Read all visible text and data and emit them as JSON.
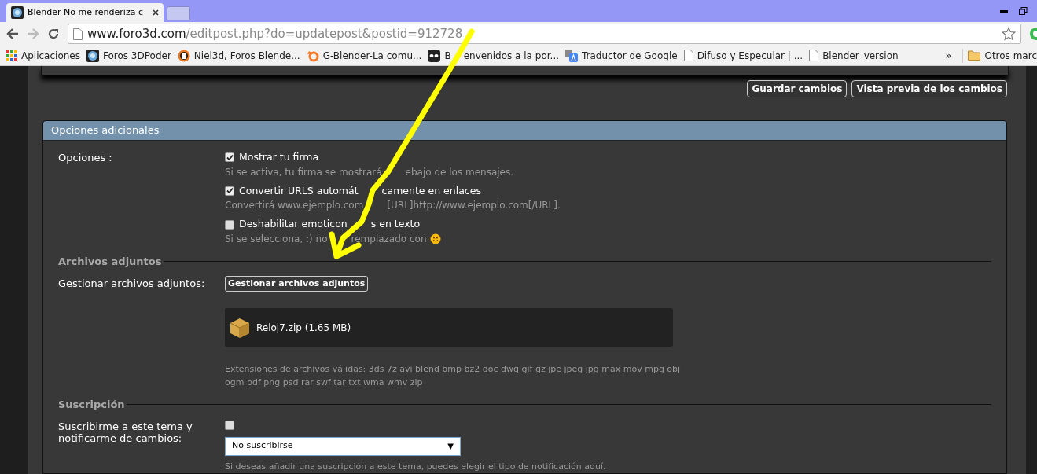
{
  "browser": {
    "tab_title": "Blender No me renderiza c",
    "url_host": "www.foro3d.com",
    "url_path": "/editpost.php?do=updatepost&postid=912728",
    "bookmarks": [
      {
        "label": [
          "Aplicaciones"
        ],
        "kind": "apps"
      },
      {
        "label": [
          "Foros 3DPoder"
        ],
        "kind": "globe"
      },
      {
        "label": [
          "Niel3d, Foros Blende..."
        ],
        "kind": "niel"
      },
      {
        "label": [
          "G-Blender-La comu..."
        ],
        "kind": "blender"
      },
      {
        "label": [
          "B",
          "envenidos a la por..."
        ],
        "kind": "mask"
      },
      {
        "label": [
          "Traductor de Google"
        ],
        "kind": "translate"
      },
      {
        "label": [
          "Difuso y Especular | ..."
        ],
        "kind": "page"
      },
      {
        "label": [
          "Blender_version"
        ],
        "kind": "page"
      }
    ],
    "overflow": "»",
    "other_bookmarks": "Otros marc"
  },
  "buttons": [
    "Guardar cambios",
    "Vista previa de los cambios"
  ],
  "panel": {
    "title": "Opciones adicionales",
    "options_label": "Opciones :",
    "options": [
      {
        "label": [
          "Mostrar tu firma"
        ],
        "checked": true,
        "hint": [
          "Si se activa, tu firma se mostrará",
          "ebajo de los mensajes."
        ]
      },
      {
        "label": [
          "Convertir URLS automát",
          "camente en enlaces"
        ],
        "checked": true,
        "hint": [
          "Convertirá www.ejemplo.com",
          "[URL]http://www.ejemplo.com[/URL]."
        ]
      },
      {
        "label": [
          "Deshabilitar emoticon",
          "s en texto"
        ],
        "checked": false,
        "hint": [
          "Si se selecciona, :) no",
          "remplazado con"
        ]
      }
    ],
    "attachments": {
      "heading": "Archivos adjuntos",
      "label": "Gestionar archivos adjuntos:",
      "button": "Gestionar archivos adjuntos",
      "file": "Reloj7.zip (1.65 MB)",
      "extensions": "Extensiones de archivos válidas: 3ds 7z avi blend bmp bz2 doc dwg gif gz jpe jpeg jpg max mov mpg obj ogm pdf png psd rar swf tar txt wma wmv zip"
    },
    "subscription": {
      "heading": "Suscripción",
      "label": "Suscribirme a este tema y notificarme de cambios:",
      "checked": false,
      "select": "No suscribirse",
      "select_arrow": "▼",
      "hint": "Si deseas añadir una suscripción a este tema, puedes elegir el tipo de notificación aquí."
    }
  }
}
